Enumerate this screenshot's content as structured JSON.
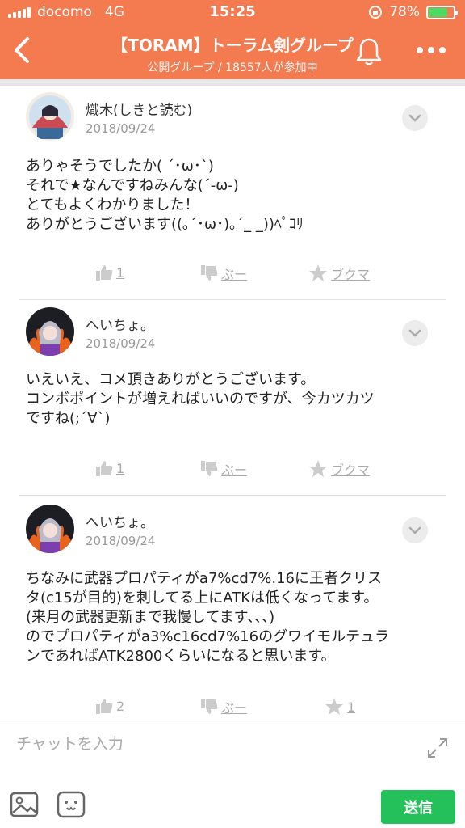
{
  "status": {
    "carrier": "docomo",
    "network": "4G",
    "time": "15:25",
    "battery": "78%",
    "battery_level": 0.78
  },
  "header": {
    "title": "【TORAM】トーラム剣グループ",
    "subtitle": "公開グループ / 18557人が参加中"
  },
  "posts": [
    {
      "user": "熾木(しきと読む)",
      "date": "2018/09/24",
      "lines": [
        "ありゃそうでしたか( ´･ω･`)",
        "それで★なんですねみんな(´-ω-)",
        "とてもよくわかりました！",
        "ありがとうございます((｡´･ω･)｡´_ _))ﾍﾟｺﾘ"
      ],
      "likes": "1",
      "boo": "ぶー",
      "bookmark": "ブクマ"
    },
    {
      "user": "へいちょ。",
      "date": "2018/09/24",
      "lines": [
        "いえいえ、コメ頂きありがとうございます。",
        "コンボポイントが増えればいいのですが、今カツカツ",
        "ですね(;´∀`)"
      ],
      "likes": "1",
      "boo": "ぶー",
      "bookmark": "ブクマ"
    },
    {
      "user": "へいちょ。",
      "date": "2018/09/24",
      "lines": [
        "ちなみに武器プロパティがa7%cd7%.16に王者クリス",
        "タ(c15が目的)を刺してる上にATKは低くなってます。",
        "(来月の武器更新まで我慢してます、、、)",
        "のでプロパティがa3%c16cd7%16のグワイモルテュラ",
        "ンであればATK2800くらいになると思います。"
      ],
      "likes": "2",
      "boo": "ぶー",
      "bookmark": "1"
    }
  ],
  "composer": {
    "placeholder": "チャットを入力",
    "send_label": "送信"
  },
  "colors": {
    "header": "#f47a4f",
    "send": "#24c05a",
    "battery": "#4cd964"
  }
}
